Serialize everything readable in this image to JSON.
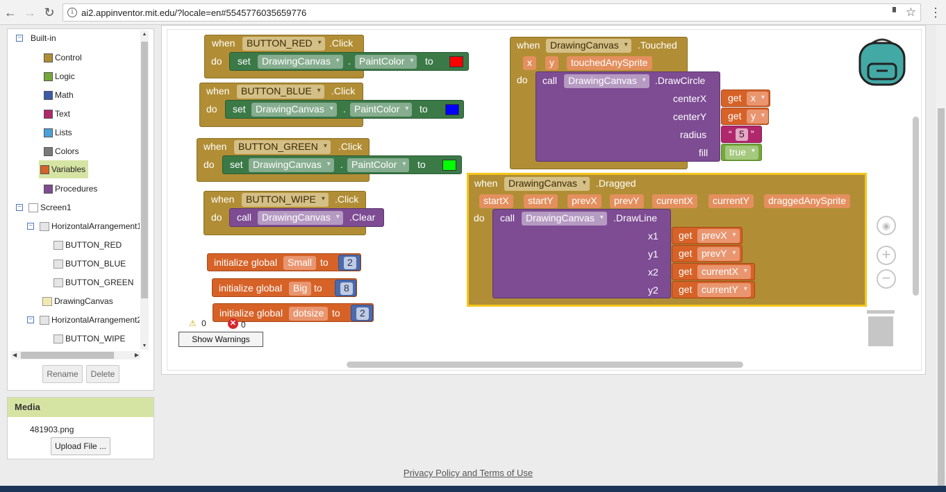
{
  "browser": {
    "url": "ai2.appinventor.mit.edu/?locale=en#5545776035659776",
    "back_icon": "←",
    "forward_icon": "→",
    "reload_icon": "↻",
    "info_icon": "i",
    "star_icon": "☆",
    "menu_icon": "⋮"
  },
  "blocks_tree": {
    "builtin_label": "Built-in",
    "builtins": [
      {
        "label": "Control",
        "color": "#b18e35"
      },
      {
        "label": "Logic",
        "color": "#75a73a"
      },
      {
        "label": "Math",
        "color": "#3c5ba5"
      },
      {
        "label": "Text",
        "color": "#b0276b"
      },
      {
        "label": "Lists",
        "color": "#4aa0d8"
      },
      {
        "label": "Colors",
        "color": "#7a7a7a"
      },
      {
        "label": "Variables",
        "color": "#d66228"
      },
      {
        "label": "Procedures",
        "color": "#7d4c93"
      }
    ],
    "screen": "Screen1",
    "components": [
      "HorizontalArrangement1",
      "BUTTON_RED",
      "BUTTON_BLUE",
      "BUTTON_GREEN",
      "DrawingCanvas",
      "HorizontalArrangement2",
      "BUTTON_WIPE"
    ],
    "rename_label": "Rename",
    "delete_label": "Delete"
  },
  "media": {
    "title": "Media",
    "file": "481903.png",
    "upload_label": "Upload File ..."
  },
  "kw": {
    "when": "when",
    "do": "do",
    "set": "set",
    "to": "to",
    "call": "call",
    "get": "get",
    "dot": ".",
    "click": ".Click",
    "paintcolor": "PaintColor",
    "clear": ".Clear",
    "init_global": "initialize global",
    "touched": ".Touched",
    "dragged": ".Dragged",
    "drawcircle": ".DrawCircle",
    "drawline": ".DrawLine",
    "centerX": "centerX",
    "centerY": "centerY",
    "radius": "radius",
    "fill": "fill",
    "x1": "x1",
    "y1": "y1",
    "x2": "x2",
    "y2": "y2",
    "q_open": "“",
    "q_close": "”"
  },
  "blocks": {
    "red_button": "BUTTON_RED",
    "blue_button": "BUTTON_BLUE",
    "green_button": "BUTTON_GREEN",
    "wipe_button": "BUTTON_WIPE",
    "canvas": "DrawingCanvas",
    "red_color": "#ff0000",
    "blue_color": "#0000ff",
    "green_color": "#00ff00",
    "globals": [
      {
        "name": "Small",
        "value": "2"
      },
      {
        "name": "Big",
        "value": "8"
      },
      {
        "name": "dotsize",
        "value": "2"
      }
    ],
    "touched_params": [
      "x",
      "y",
      "touchedAnySprite"
    ],
    "circle_centerx": "x",
    "circle_centery": "y",
    "circle_radius": "5",
    "circle_fill": "true",
    "dragged_params": [
      "startX",
      "startY",
      "prevX",
      "prevY",
      "currentX",
      "currentY",
      "draggedAnySprite"
    ],
    "line_x1": "prevX",
    "line_y1": "prevY",
    "line_x2": "currentX",
    "line_y2": "currentY"
  },
  "warnings": {
    "warning_count": "0",
    "error_count": "0",
    "show_warnings_label": "Show Warnings"
  },
  "footer": {
    "link": "Privacy Policy and Terms of Use"
  }
}
